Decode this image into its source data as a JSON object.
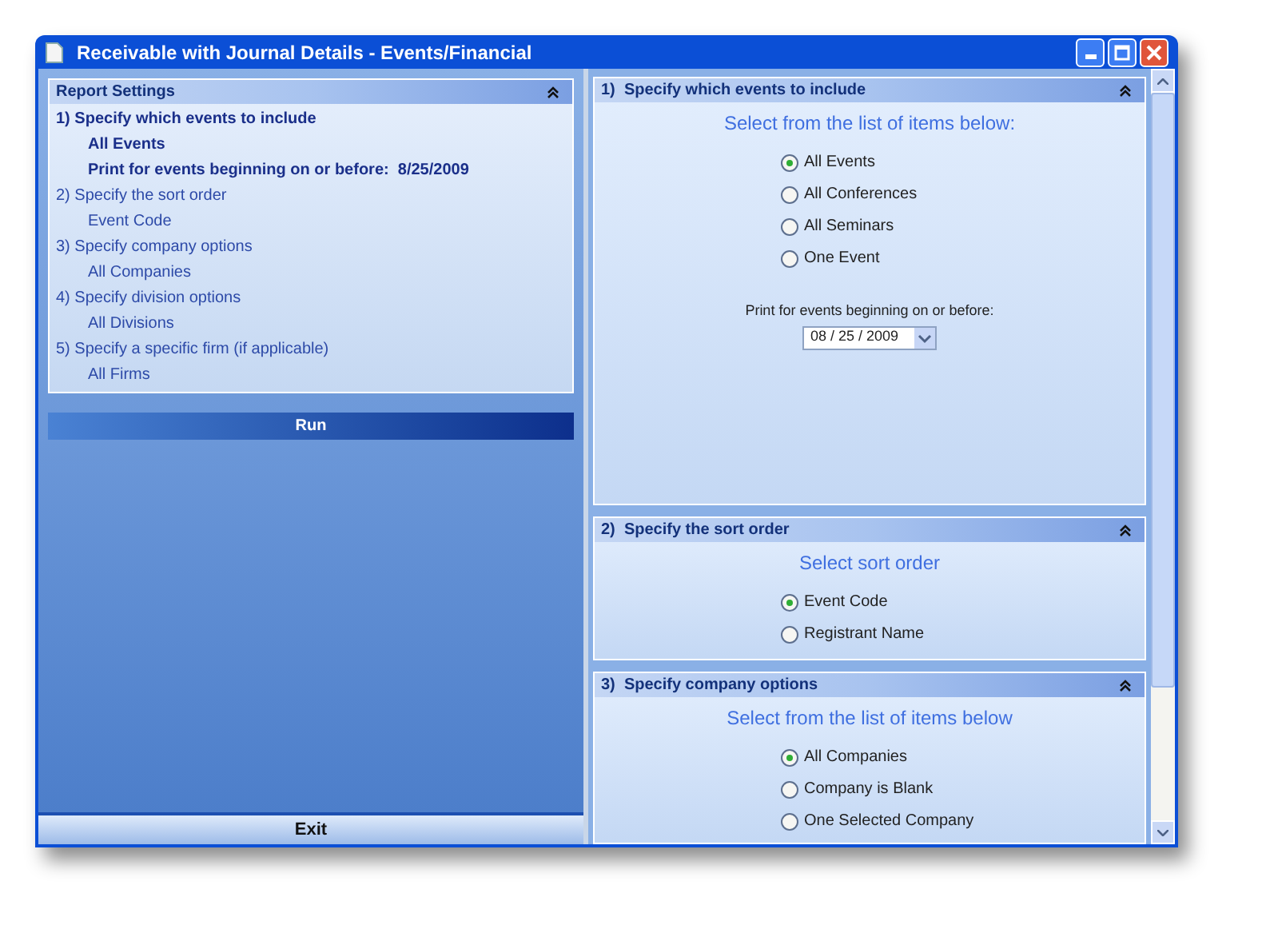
{
  "window": {
    "title": "Receivable with Journal Details - Events/Financial"
  },
  "report_settings": {
    "title": "Report Settings",
    "sections": [
      {
        "title": "1)  Specify which events to include",
        "active": true,
        "values": [
          "All Events",
          "Print for events beginning on or before:  8/25/2009"
        ]
      },
      {
        "title": "2)  Specify the sort order",
        "active": false,
        "values": [
          "Event Code"
        ]
      },
      {
        "title": "3)  Specify company options",
        "active": false,
        "values": [
          "All Companies"
        ]
      },
      {
        "title": "4)  Specify division options",
        "active": false,
        "values": [
          "All Divisions"
        ]
      },
      {
        "title": "5)  Specify a specific firm (if applicable)",
        "active": false,
        "values": [
          "All Firms"
        ]
      }
    ]
  },
  "run_button": "Run",
  "exit_button": "Exit",
  "panels": [
    {
      "title": "1)  Specify which events to include",
      "prompt": "Select from the list of items below:",
      "options": [
        {
          "label": "All Events",
          "selected": true
        },
        {
          "label": "All Conferences",
          "selected": false
        },
        {
          "label": "All Seminars",
          "selected": false
        },
        {
          "label": "One Event",
          "selected": false
        }
      ],
      "date_label": "Print for events beginning on or before:",
      "date_value": "08 / 25 / 2009"
    },
    {
      "title": "2)  Specify the sort order",
      "prompt": "Select sort order",
      "options": [
        {
          "label": "Event Code",
          "selected": true
        },
        {
          "label": "Registrant Name",
          "selected": false
        }
      ]
    },
    {
      "title": "3)  Specify company options",
      "prompt": "Select from the list of items below",
      "options": [
        {
          "label": "All Companies",
          "selected": true
        },
        {
          "label": "Company is Blank",
          "selected": false
        },
        {
          "label": "One Selected Company",
          "selected": false
        }
      ]
    }
  ]
}
